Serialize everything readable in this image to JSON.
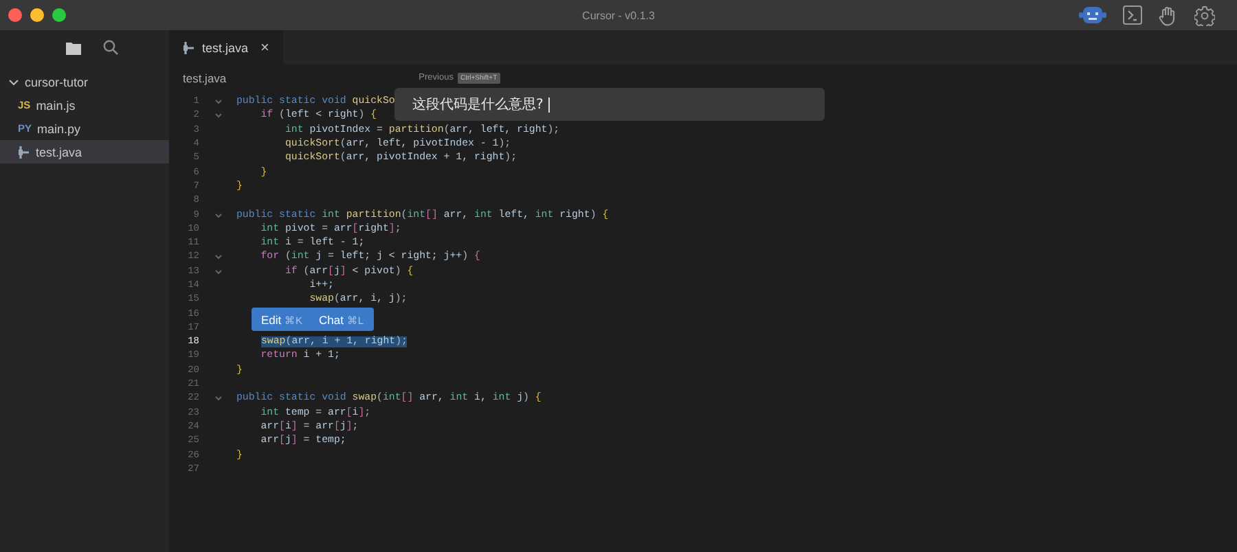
{
  "window": {
    "title": "Cursor - v0.1.3"
  },
  "toolbar": [
    {
      "kind": "robot",
      "selected": true
    },
    {
      "kind": "terminal",
      "selected": false
    },
    {
      "kind": "hand",
      "selected": false
    },
    {
      "kind": "settings",
      "selected": false
    }
  ],
  "sidebar": {
    "views": [
      {
        "kind": "files",
        "selected": true
      },
      {
        "kind": "search",
        "selected": false
      }
    ],
    "tree": [
      {
        "label": "cursor-tutor",
        "kind": "folder",
        "expanded": true,
        "selected": false,
        "children": [
          {
            "label": "main.js",
            "kind": "file",
            "badge": "JS",
            "color": "#d6b64a",
            "selected": false
          },
          {
            "label": "main.py",
            "kind": "file",
            "badge": "PY",
            "color": "#6d8fc4",
            "selected": false
          },
          {
            "label": "test.java",
            "kind": "java",
            "selected": true
          }
        ]
      }
    ]
  },
  "tabs": [
    {
      "label": "test.java",
      "close": "×",
      "selected": true
    }
  ],
  "breadcrumb": "test.java",
  "history": {
    "label": "Previous",
    "shortcut": "Ctrl+Shift+T"
  },
  "prompt": {
    "value": "这段代码是什么意思?"
  },
  "selection_menu": [
    {
      "label": "Edit",
      "shortcut": "⌘K"
    },
    {
      "label": "Chat",
      "shortcut": "⌘L"
    }
  ],
  "code": [
    {
      "n": "1",
      "fold": true,
      "selected": false,
      "tokens": [
        {
          "kind": "kw",
          "text": "public static void "
        },
        {
          "kind": "fn",
          "text": "quickSo"
        }
      ]
    },
    {
      "n": "2",
      "fold": true,
      "selected": false,
      "tokens": [
        {
          "kind": "ctl",
          "text": "    if"
        },
        {
          "kind": "p",
          "text": " ("
        },
        {
          "kind": "id",
          "text": "left < right"
        },
        {
          "kind": "p",
          "text": ") "
        },
        {
          "kind": "br",
          "text": "{"
        }
      ]
    },
    {
      "n": "3",
      "fold": false,
      "selected": false,
      "tokens": [
        {
          "kind": "ty",
          "text": "        int"
        },
        {
          "kind": "id",
          "text": " pivotIndex = "
        },
        {
          "kind": "fn",
          "text": "partition"
        },
        {
          "kind": "p",
          "text": "("
        },
        {
          "kind": "id",
          "text": "arr, left, right"
        },
        {
          "kind": "p",
          "text": ");"
        }
      ]
    },
    {
      "n": "4",
      "fold": false,
      "selected": false,
      "tokens": [
        {
          "kind": "fn",
          "text": "        quickSort"
        },
        {
          "kind": "p",
          "text": "("
        },
        {
          "kind": "id",
          "text": "arr, left, pivotIndex - 1"
        },
        {
          "kind": "p",
          "text": ");"
        }
      ]
    },
    {
      "n": "5",
      "fold": false,
      "selected": false,
      "tokens": [
        {
          "kind": "fn",
          "text": "        quickSort"
        },
        {
          "kind": "p",
          "text": "("
        },
        {
          "kind": "id",
          "text": "arr, pivotIndex + 1, right"
        },
        {
          "kind": "p",
          "text": ");"
        }
      ]
    },
    {
      "n": "6",
      "fold": false,
      "selected": false,
      "tokens": [
        {
          "kind": "br",
          "text": "    }"
        }
      ]
    },
    {
      "n": "7",
      "fold": false,
      "selected": false,
      "tokens": [
        {
          "kind": "br",
          "text": "}"
        }
      ]
    },
    {
      "n": "8",
      "fold": false,
      "selected": false
    },
    {
      "n": "9",
      "fold": true,
      "selected": false,
      "tokens": [
        {
          "kind": "kw",
          "text": "public static "
        },
        {
          "kind": "ty",
          "text": "int "
        },
        {
          "kind": "fn",
          "text": "partition"
        },
        {
          "kind": "p",
          "text": "("
        },
        {
          "kind": "ty",
          "text": "int"
        },
        {
          "kind": "sq",
          "text": "[]"
        },
        {
          "kind": "id",
          "text": " arr, "
        },
        {
          "kind": "ty",
          "text": "int"
        },
        {
          "kind": "id",
          "text": " left, "
        },
        {
          "kind": "ty",
          "text": "int"
        },
        {
          "kind": "id",
          "text": " right"
        },
        {
          "kind": "p",
          "text": ") "
        },
        {
          "kind": "br",
          "text": "{"
        }
      ]
    },
    {
      "n": "10",
      "fold": false,
      "selected": false,
      "tokens": [
        {
          "kind": "ty",
          "text": "    int"
        },
        {
          "kind": "id",
          "text": " pivot = arr"
        },
        {
          "kind": "sq",
          "text": "["
        },
        {
          "kind": "id",
          "text": "right"
        },
        {
          "kind": "sq",
          "text": "]"
        },
        {
          "kind": "p",
          "text": ";"
        }
      ]
    },
    {
      "n": "11",
      "fold": false,
      "selected": false,
      "tokens": [
        {
          "kind": "ty",
          "text": "    int"
        },
        {
          "kind": "id",
          "text": " i = left - 1;"
        }
      ]
    },
    {
      "n": "12",
      "fold": true,
      "selected": false,
      "tokens": [
        {
          "kind": "ctl",
          "text": "    for"
        },
        {
          "kind": "p",
          "text": " ("
        },
        {
          "kind": "ty",
          "text": "int"
        },
        {
          "kind": "id",
          "text": " j = left; j < right; j++"
        },
        {
          "kind": "p",
          "text": ") "
        },
        {
          "kind": "sq",
          "text": "{"
        }
      ]
    },
    {
      "n": "13",
      "fold": true,
      "selected": false,
      "tokens": [
        {
          "kind": "ctl",
          "text": "        if"
        },
        {
          "kind": "p",
          "text": " ("
        },
        {
          "kind": "id",
          "text": "arr"
        },
        {
          "kind": "sq",
          "text": "["
        },
        {
          "kind": "id",
          "text": "j"
        },
        {
          "kind": "sq",
          "text": "]"
        },
        {
          "kind": "id",
          "text": " < pivot"
        },
        {
          "kind": "p",
          "text": ") "
        },
        {
          "kind": "br",
          "text": "{"
        }
      ]
    },
    {
      "n": "14",
      "fold": false,
      "selected": false,
      "tokens": [
        {
          "kind": "id",
          "text": "            i++;"
        }
      ]
    },
    {
      "n": "15",
      "fold": false,
      "selected": false,
      "tokens": [
        {
          "kind": "fn",
          "text": "            swap"
        },
        {
          "kind": "p",
          "text": "("
        },
        {
          "kind": "id",
          "text": "arr, i, j"
        },
        {
          "kind": "p",
          "text": ");"
        }
      ]
    },
    {
      "n": "16",
      "fold": false,
      "selected": false
    },
    {
      "n": "17",
      "fold": false,
      "selected": false
    },
    {
      "n": "18",
      "fold": false,
      "selected": true,
      "tokens": [
        {
          "kind": "fn",
          "text": "swap"
        },
        {
          "kind": "p",
          "text": "("
        },
        {
          "kind": "id",
          "text": "arr, i + 1, right"
        },
        {
          "kind": "p",
          "text": ");"
        }
      ]
    },
    {
      "n": "19",
      "fold": false,
      "selected": false,
      "tokens": [
        {
          "kind": "ctl",
          "text": "    return"
        },
        {
          "kind": "id",
          "text": " i + 1;"
        }
      ]
    },
    {
      "n": "20",
      "fold": false,
      "selected": false,
      "tokens": [
        {
          "kind": "br",
          "text": "}"
        }
      ]
    },
    {
      "n": "21",
      "fold": false,
      "selected": false
    },
    {
      "n": "22",
      "fold": true,
      "selected": false,
      "tokens": [
        {
          "kind": "kw",
          "text": "public static void "
        },
        {
          "kind": "fn",
          "text": "swap"
        },
        {
          "kind": "p",
          "text": "("
        },
        {
          "kind": "ty",
          "text": "int"
        },
        {
          "kind": "sq",
          "text": "[]"
        },
        {
          "kind": "id",
          "text": " arr, "
        },
        {
          "kind": "ty",
          "text": "int"
        },
        {
          "kind": "id",
          "text": " i, "
        },
        {
          "kind": "ty",
          "text": "int"
        },
        {
          "kind": "id",
          "text": " j"
        },
        {
          "kind": "p",
          "text": ") "
        },
        {
          "kind": "br",
          "text": "{"
        }
      ]
    },
    {
      "n": "23",
      "fold": false,
      "selected": false,
      "tokens": [
        {
          "kind": "ty",
          "text": "    int"
        },
        {
          "kind": "id",
          "text": " temp = arr"
        },
        {
          "kind": "sq",
          "text": "["
        },
        {
          "kind": "id",
          "text": "i"
        },
        {
          "kind": "sq",
          "text": "]"
        },
        {
          "kind": "p",
          "text": ";"
        }
      ]
    },
    {
      "n": "24",
      "fold": false,
      "selected": false,
      "tokens": [
        {
          "kind": "id",
          "text": "    arr"
        },
        {
          "kind": "sq",
          "text": "["
        },
        {
          "kind": "id",
          "text": "i"
        },
        {
          "kind": "sq",
          "text": "]"
        },
        {
          "kind": "id",
          "text": " = arr"
        },
        {
          "kind": "sq",
          "text": "["
        },
        {
          "kind": "id",
          "text": "j"
        },
        {
          "kind": "sq",
          "text": "]"
        },
        {
          "kind": "p",
          "text": ";"
        }
      ]
    },
    {
      "n": "25",
      "fold": false,
      "selected": false,
      "tokens": [
        {
          "kind": "id",
          "text": "    arr"
        },
        {
          "kind": "sq",
          "text": "["
        },
        {
          "kind": "id",
          "text": "j"
        },
        {
          "kind": "sq",
          "text": "]"
        },
        {
          "kind": "id",
          "text": " = temp;"
        }
      ]
    },
    {
      "n": "26",
      "fold": false,
      "selected": false,
      "tokens": [
        {
          "kind": "br",
          "text": "}"
        }
      ]
    },
    {
      "n": "27",
      "fold": false,
      "selected": false
    }
  ]
}
